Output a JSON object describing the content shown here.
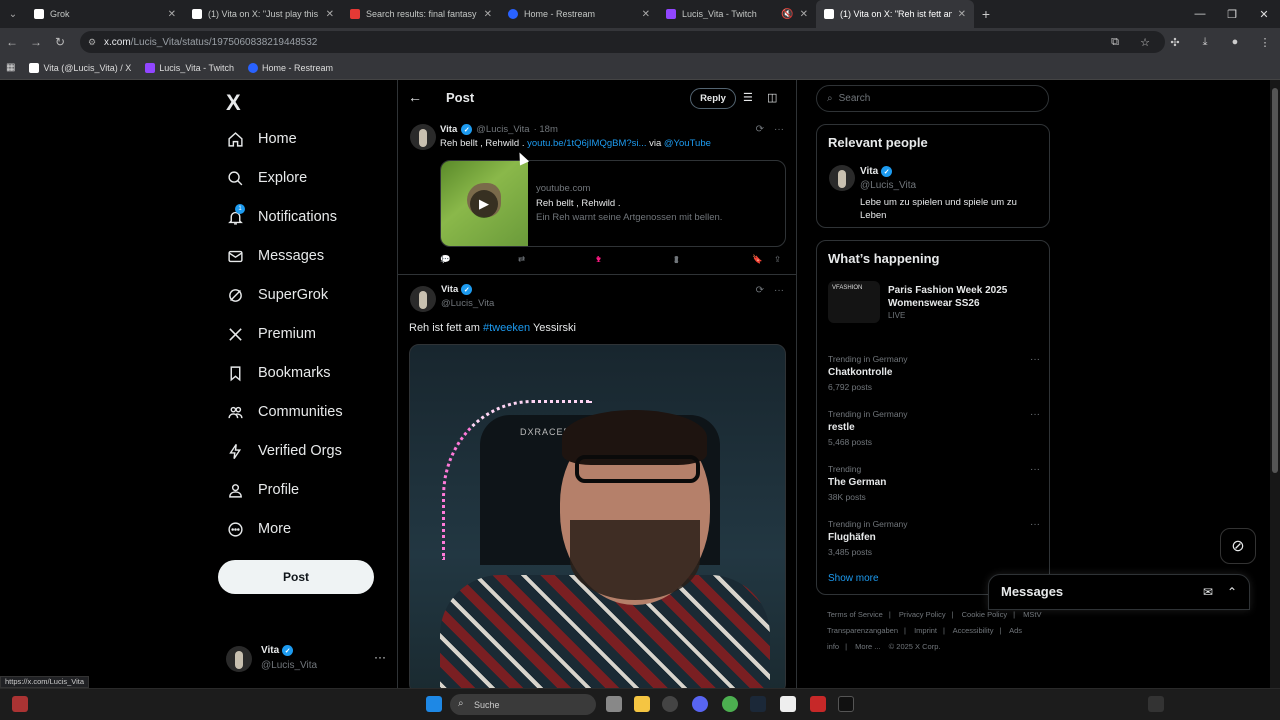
{
  "browser": {
    "tabs": [
      {
        "title": "Grok",
        "color": "#ffffff"
      },
      {
        "title": "(1) Vita on X: \"Just play this ne",
        "color": "#ffffff"
      },
      {
        "title": "Search results: final fantasy",
        "color": "#e53935"
      },
      {
        "title": "Home - Restream",
        "color": "#2962ff"
      },
      {
        "title": "Lucis_Vita - Twitch",
        "color": "#9146ff"
      },
      {
        "title": "(1) Vita on X: \"Reh ist fett am #",
        "color": "#ffffff"
      }
    ],
    "url_host": "x.com",
    "url_path": "/Lucis_Vita/status/1975060838219448532",
    "bookmarks": [
      {
        "label": "Vita (@Lucis_Vita) / X",
        "color": "#ffffff"
      },
      {
        "label": "Lucis_Vita - Twitch",
        "color": "#9146ff"
      },
      {
        "label": "Home - Restream",
        "color": "#2962ff"
      }
    ],
    "status_url": "https://x.com/Lucis_Vita"
  },
  "nav": {
    "logo": "X",
    "items": [
      {
        "label": "Home",
        "icon": "home-icon"
      },
      {
        "label": "Explore",
        "icon": "search-icon"
      },
      {
        "label": "Notifications",
        "icon": "bell-icon",
        "badge": "1"
      },
      {
        "label": "Messages",
        "icon": "mail-icon"
      },
      {
        "label": "SuperGrok",
        "icon": "grok-icon"
      },
      {
        "label": "Premium",
        "icon": "x-icon"
      },
      {
        "label": "Bookmarks",
        "icon": "bookmark-icon"
      },
      {
        "label": "Communities",
        "icon": "people-icon"
      },
      {
        "label": "Verified Orgs",
        "icon": "bolt-icon"
      },
      {
        "label": "Profile",
        "icon": "person-icon"
      },
      {
        "label": "More",
        "icon": "more-circle-icon"
      }
    ],
    "post_label": "Post",
    "account": {
      "name": "Vita",
      "handle": "@Lucis_Vita"
    }
  },
  "main": {
    "title": "Post",
    "reply_label": "Reply",
    "tweet1": {
      "name": "Vita",
      "handle": "@Lucis_Vita",
      "time": "· 18m",
      "text": "Reh bellt , Rehwild .",
      "link": "youtu.be/1tQ6jIMQgBM?si...",
      "via": "via",
      "mention": "@YouTube",
      "card": {
        "domain": "youtube.com",
        "title": "Reh bellt , Rehwild .",
        "description": "Ein Reh warnt seine Artgenossen mit bellen."
      },
      "replies": "1",
      "likes": "1",
      "views": "2"
    },
    "tweet2": {
      "name": "Vita",
      "handle": "@Lucis_Vita",
      "text_pre": "Reh ist fett am",
      "hashtag": "#tweeken",
      "text_post": "Yessirski",
      "media_logo": "DXRACER"
    }
  },
  "right": {
    "search_placeholder": "Search",
    "relevant": {
      "title": "Relevant people",
      "name": "Vita",
      "handle": "@Lucis_Vita",
      "bio": "Lebe um zu spielen und spiele um zu Leben"
    },
    "happening": {
      "title": "What’s happening",
      "featured": {
        "title": "Paris Fashion Week 2025 Womenswear SS26",
        "status": "LIVE",
        "img_text": "VFASHION"
      },
      "trends": [
        {
          "category": "Trending in Germany",
          "name": "Chatkontrolle",
          "count": "6,792 posts"
        },
        {
          "category": "Trending in Germany",
          "name": "restle",
          "count": "5,468 posts"
        },
        {
          "category": "Trending",
          "name": "The German",
          "count": "38K posts"
        },
        {
          "category": "Trending in Germany",
          "name": "Flughäfen",
          "count": "3,485 posts"
        }
      ],
      "show_more": "Show more"
    },
    "footer": [
      "Terms of Service",
      "|",
      "Privacy Policy",
      "|",
      "Cookie Policy",
      "|",
      "MStV Transparenzangaben",
      "|",
      "Imprint",
      "|",
      "Accessibility",
      "|",
      "Ads info",
      "|",
      "More ...",
      "© 2025 X Corp."
    ],
    "messages_label": "Messages"
  },
  "taskbar": {
    "search_placeholder": "Suche"
  }
}
